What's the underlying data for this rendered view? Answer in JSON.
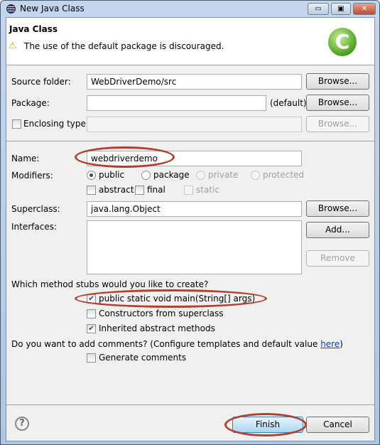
{
  "window": {
    "title": "New Java Class",
    "minimize": "▭",
    "maximize": "▣",
    "close": "✕"
  },
  "header": {
    "title": "Java Class",
    "warning": "The use of the default package is discouraged.",
    "icon": "java-class-c-icon",
    "icon_letter": "C"
  },
  "form": {
    "source_folder": {
      "label": "Source folder:",
      "value": "WebDriverDemo/src",
      "button": "Browse..."
    },
    "package": {
      "label": "Package:",
      "value": "",
      "hint": "(default)",
      "button": "Browse..."
    },
    "enclosing": {
      "label": "Enclosing type:",
      "checked": false,
      "value": "",
      "button": "Browse..."
    },
    "name": {
      "label": "Name:",
      "value": "webdriverdemo"
    },
    "modifiers": {
      "label": "Modifiers:",
      "radios": [
        "public",
        "package",
        "private",
        "protected"
      ],
      "selected": "public",
      "checks": [
        "abstract",
        "final",
        "static"
      ]
    },
    "superclass": {
      "label": "Superclass:",
      "value": "java.lang.Object",
      "button": "Browse..."
    },
    "interfaces": {
      "label": "Interfaces:",
      "add": "Add...",
      "remove": "Remove"
    },
    "stubs": {
      "question": "Which method stubs would you like to create?",
      "options": [
        {
          "label": "public static void main(String[] args)",
          "checked": true
        },
        {
          "label": "Constructors from superclass",
          "checked": false
        },
        {
          "label": "Inherited abstract methods",
          "checked": true
        }
      ]
    },
    "comments": {
      "question": "Do you want to add comments? (Configure templates and default value ",
      "link": "here",
      "close": ")",
      "option": "Generate comments",
      "checked": false
    }
  },
  "footer": {
    "help": "?",
    "finish": "Finish",
    "cancel": "Cancel"
  },
  "colors": {
    "highlight": "#b04030",
    "link": "#0645ad"
  }
}
